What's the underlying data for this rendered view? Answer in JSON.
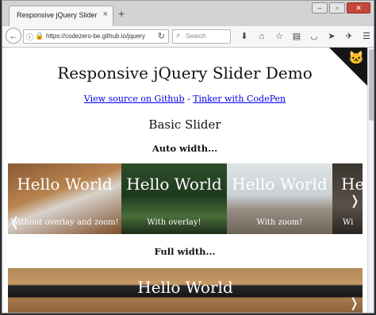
{
  "browser": {
    "tab_title": "Responsive jQuery Slider",
    "tab_close": "×",
    "new_tab": "+",
    "url": "https://codezero-be.github.io/jquery",
    "search_placeholder": "Search"
  },
  "page": {
    "title": "Responsive jQuery Slider Demo",
    "link_github": "View source on Github",
    "link_sep": " - ",
    "link_codepen": "Tinker with CodePen",
    "section_title": "Basic Slider",
    "auto_width_heading": "Auto width...",
    "full_width_heading": "Full width..."
  },
  "slider_auto": {
    "slides": [
      {
        "title": "Hello World",
        "caption": "Without overlay and zoom!"
      },
      {
        "title": "Hello World",
        "caption": "With overlay!"
      },
      {
        "title": "Hello World",
        "caption": "With zoom!"
      },
      {
        "title": "He",
        "caption": "Wi"
      }
    ]
  },
  "slider_full": {
    "slides": [
      {
        "title": "Hello World"
      }
    ]
  },
  "icons": {
    "prev": "❬",
    "next": "❭"
  }
}
